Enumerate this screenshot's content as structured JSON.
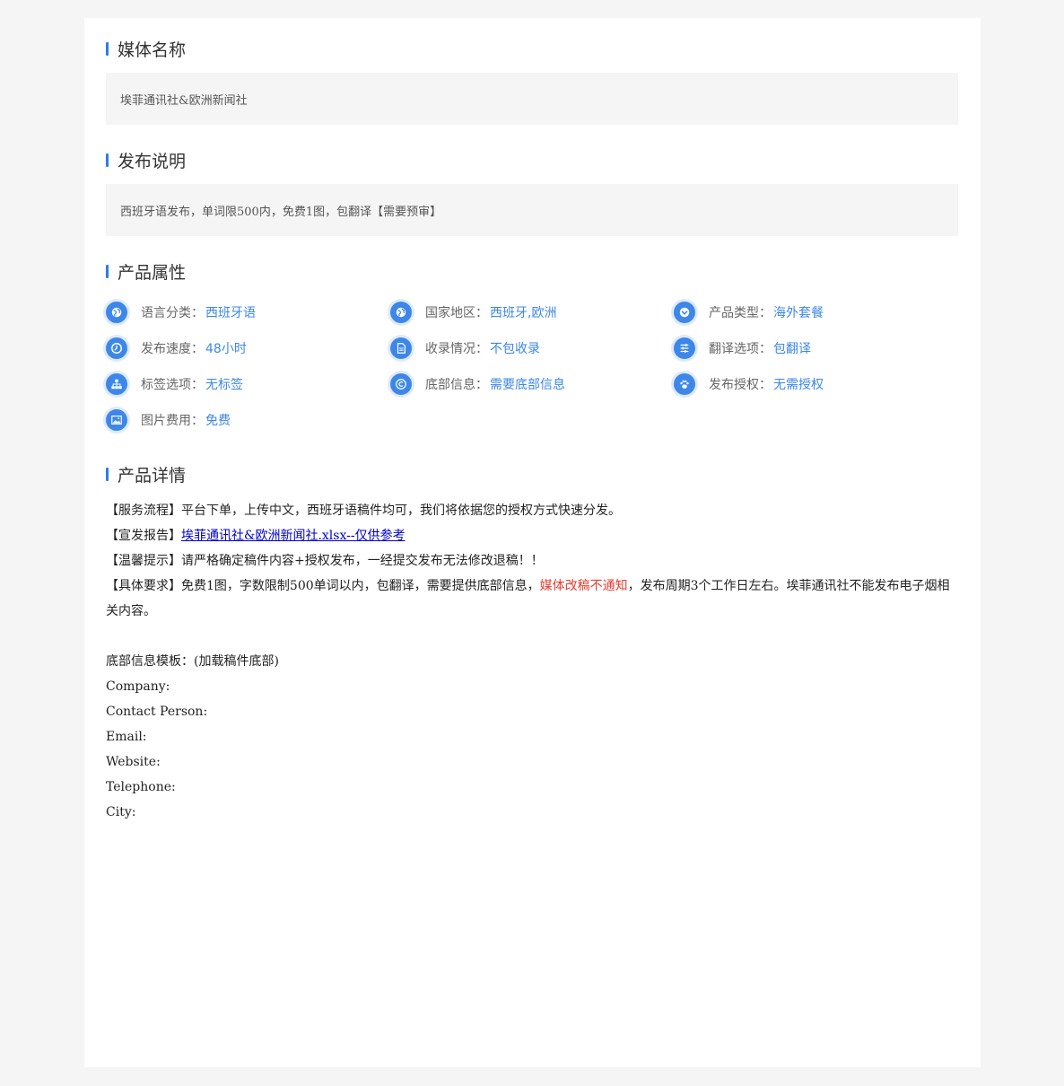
{
  "media_name": {
    "title": "媒体名称",
    "value": "埃菲通讯社&欧洲新闻社"
  },
  "publish_note": {
    "title": "发布说明",
    "value": "西班牙语发布，单词限500内，免费1图，包翻译【需要预审】"
  },
  "attributes": {
    "title": "产品属性",
    "language": {
      "label": "语言分类：",
      "value": "西班牙语",
      "icon": "globe-icon"
    },
    "region": {
      "label": "国家地区：",
      "value": "西班牙,欧洲",
      "icon": "globe-icon"
    },
    "product_type": {
      "label": "产品类型：",
      "value": "海外套餐",
      "icon": "chevron-down-icon"
    },
    "speed": {
      "label": "发布速度：",
      "value": "48小时",
      "icon": "clock-icon"
    },
    "indexing": {
      "label": "收录情况：",
      "value": "不包收录",
      "icon": "document-icon"
    },
    "translation": {
      "label": "翻译选项：",
      "value": "包翻译",
      "icon": "sliders-icon"
    },
    "tags": {
      "label": "标签选项：",
      "value": "无标签",
      "icon": "sitemap-icon"
    },
    "footer_info": {
      "label": "底部信息：",
      "value": "需要底部信息",
      "icon": "copyright-icon"
    },
    "authorization": {
      "label": "发布授权：",
      "value": "无需授权",
      "icon": "paw-icon"
    },
    "image_fee": {
      "label": "图片费用：",
      "value": "免费",
      "icon": "image-icon"
    }
  },
  "details": {
    "title": "产品详情",
    "line1": "【服务流程】平台下单，上传中文，西班牙语稿件均可，我们将依据您的授权方式快速分发。",
    "line2_prefix": "【宣发报告】",
    "line2_link": "埃菲通讯社&欧洲新闻社.xlsx--仅供参考",
    "line3": "【温馨提示】请严格确定稿件内容+授权发布，一经提交发布无法修改退稿！！",
    "line4_prefix": "【具体要求】免费1图，字数限制500单词以内，包翻译，需要提供底部信息，",
    "line4_red": "媒体改稿不通知",
    "line4_suffix": "，发布周期3个工作日左右。埃菲通讯社不能发布电子烟相关内容。",
    "template_title": "底部信息模板：(加载稿件底部)",
    "fields": [
      "Company:",
      "Contact Person:",
      "Email:",
      "Website:",
      "Telephone:",
      "City:"
    ]
  },
  "colors": {
    "accent": "#3d87e8",
    "title_bar": "#2f7de1",
    "warning_red": "#e53d2f",
    "link": "#0000cc"
  }
}
